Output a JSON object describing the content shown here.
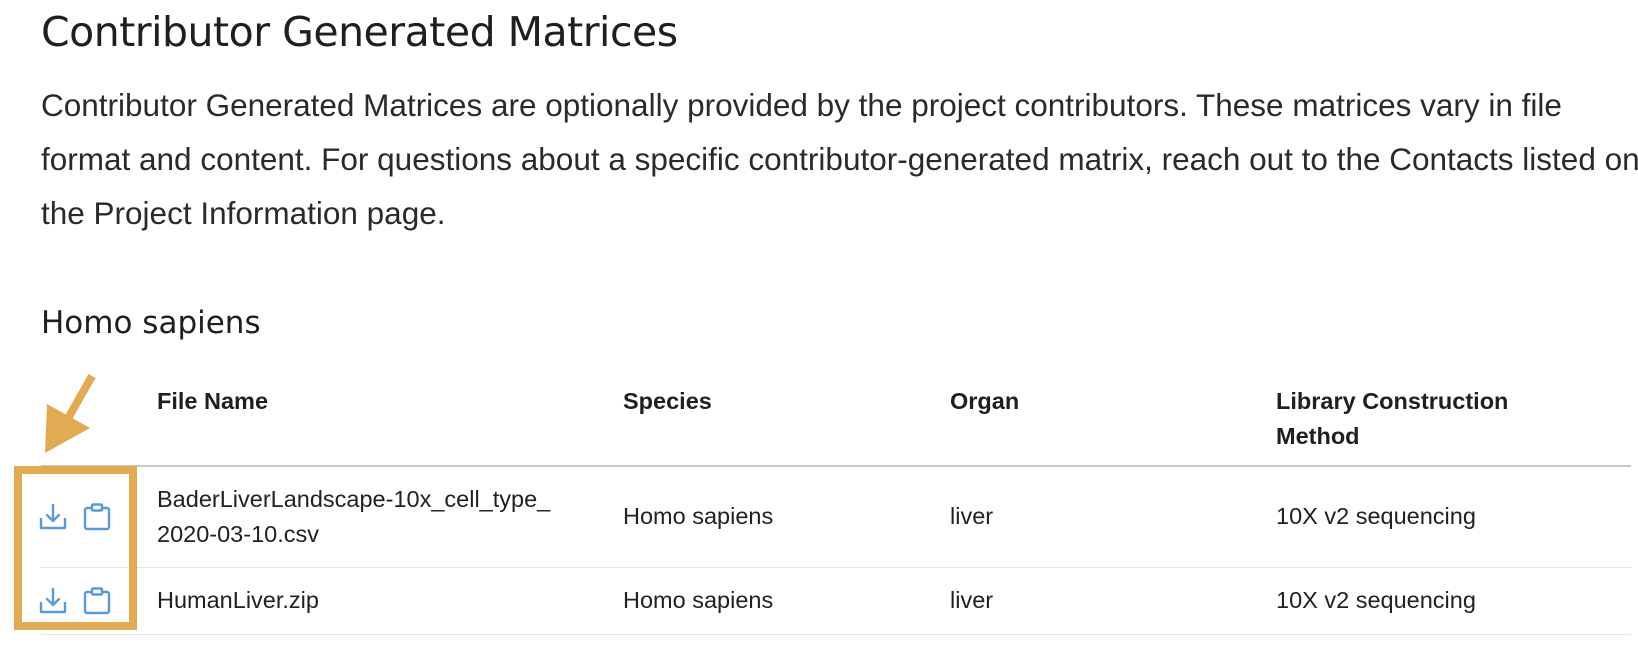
{
  "title": "Contributor Generated Matrices",
  "description": "Contributor Generated Matrices are optionally provided by the project contributors. These matrices vary in file format and content. For questions about a specific contributor-generated matrix, reach out to the Contacts listed on the Project Information page.",
  "section": {
    "title": "Homo sapiens"
  },
  "table": {
    "headers": {
      "file_name": "File Name",
      "species": "Species",
      "organ": "Organ",
      "library_line1": "Library Construction",
      "library_line2": "Method"
    },
    "rows": [
      {
        "file_name_line1": "BaderLiverLandscape-10x_cell_type_",
        "file_name_line2": "2020-03-10.csv",
        "species": "Homo sapiens",
        "organ": "liver",
        "library_method": "10X v2 sequencing",
        "download_icon": "download-icon",
        "copy_icon": "clipboard-icon"
      },
      {
        "file_name_line1": "HumanLiver.zip",
        "species": "Homo sapiens",
        "organ": "liver",
        "library_method": "10X v2 sequencing",
        "download_icon": "download-icon",
        "copy_icon": "clipboard-icon"
      }
    ]
  },
  "colors": {
    "icon": "#5b9bd5",
    "highlight": "#e0ab52",
    "header_rule": "#c8c8c8",
    "row_rule": "#e6e6e6"
  }
}
